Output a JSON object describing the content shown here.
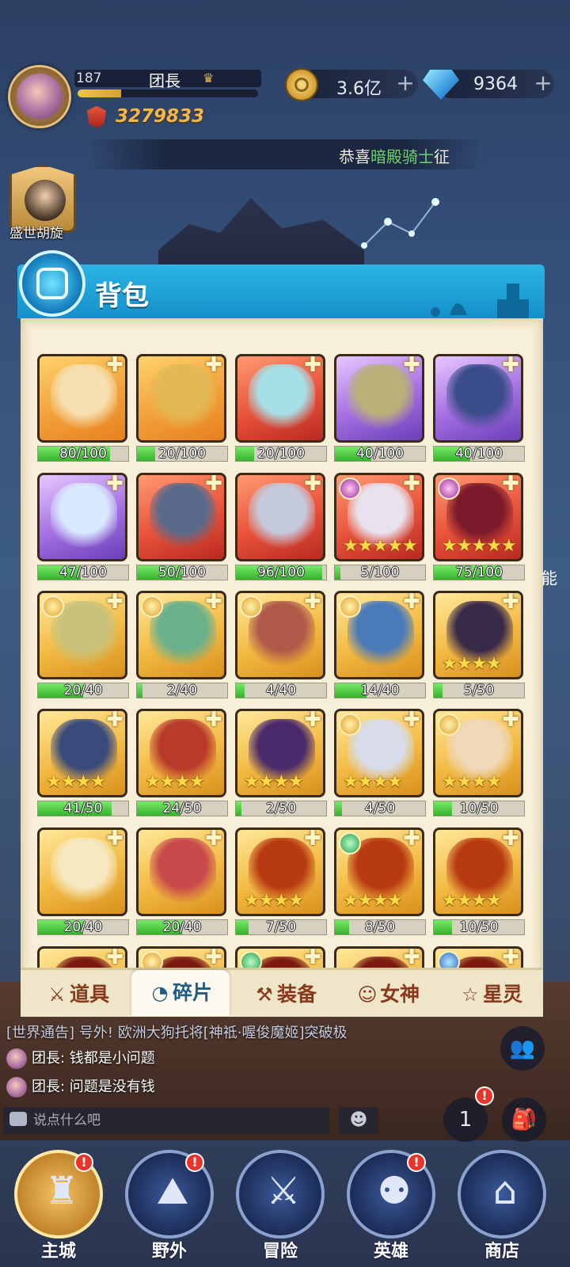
{
  "hud": {
    "level": "187",
    "player_name": "团長",
    "exp_fraction": 0.24,
    "power": "3279833",
    "gold": "3.6亿",
    "diamonds": "9364",
    "plus": "+",
    "marquee_prefix": "恭喜",
    "marquee_highlight": "暗殿骑士",
    "marquee_suffix": "征"
  },
  "event": {
    "label": "盛世胡旋"
  },
  "panel": {
    "title": "背包"
  },
  "items": [
    {
      "color": "orange",
      "art": "#f6e0b0",
      "count": "80/100",
      "fill": 0.8,
      "stars": "",
      "badge": ""
    },
    {
      "color": "orange",
      "art": "#e3b955",
      "count": "20/100",
      "fill": 0.2,
      "stars": "",
      "badge": ""
    },
    {
      "color": "red",
      "art": "#a7dfe6",
      "count": "20/100",
      "fill": 0.2,
      "stars": "",
      "badge": ""
    },
    {
      "color": "purple",
      "art": "#b9b07a",
      "count": "40/100",
      "fill": 0.4,
      "stars": "",
      "badge": ""
    },
    {
      "color": "purple",
      "art": "#3a4c8a",
      "count": "40/100",
      "fill": 0.4,
      "stars": "",
      "badge": ""
    },
    {
      "color": "purple",
      "art": "#d9e9ff",
      "count": "47/100",
      "fill": 0.47,
      "stars": "",
      "badge": ""
    },
    {
      "color": "red",
      "art": "#5a6a8a",
      "count": "50/100",
      "fill": 0.5,
      "stars": "",
      "badge": ""
    },
    {
      "color": "red",
      "art": "#c4c9dc",
      "count": "96/100",
      "fill": 0.96,
      "stars": "",
      "badge": ""
    },
    {
      "color": "red",
      "art": "#e8e2ee",
      "count": "5/100",
      "fill": 0.05,
      "stars": "★★★★★",
      "badge": "pink"
    },
    {
      "color": "red",
      "art": "#7a1a2a",
      "count": "75/100",
      "fill": 0.75,
      "stars": "★★★★★",
      "badge": "pink"
    },
    {
      "color": "gold",
      "art": "#c9c27a",
      "count": "20/40",
      "fill": 0.5,
      "stars": "",
      "badge": "gold"
    },
    {
      "color": "gold",
      "art": "#6ab08a",
      "count": "2/40",
      "fill": 0.05,
      "stars": "",
      "badge": "gold"
    },
    {
      "color": "gold",
      "art": "#b05a4a",
      "count": "4/40",
      "fill": 0.1,
      "stars": "",
      "badge": "gold"
    },
    {
      "color": "gold",
      "art": "#4a7ab8",
      "count": "14/40",
      "fill": 0.35,
      "stars": "",
      "badge": "gold"
    },
    {
      "color": "gold",
      "art": "#3a2a4a",
      "count": "5/50",
      "fill": 0.1,
      "stars": "★★★★",
      "badge": ""
    },
    {
      "color": "gold",
      "art": "#3a4a7a",
      "count": "41/50",
      "fill": 0.82,
      "stars": "★★★★",
      "badge": ""
    },
    {
      "color": "gold",
      "art": "#b83a2a",
      "count": "24/50",
      "fill": 0.48,
      "stars": "★★★★",
      "badge": ""
    },
    {
      "color": "gold",
      "art": "#4a2a6a",
      "count": "2/50",
      "fill": 0.04,
      "stars": "★★★★",
      "badge": ""
    },
    {
      "color": "gold",
      "art": "#d8dce8",
      "count": "4/50",
      "fill": 0.08,
      "stars": "★★★★",
      "badge": "gold"
    },
    {
      "color": "gold",
      "art": "#f0d8b8",
      "count": "10/50",
      "fill": 0.2,
      "stars": "★★★★",
      "badge": "gold"
    },
    {
      "color": "gold",
      "art": "#f6e8c0",
      "count": "20/40",
      "fill": 0.5,
      "stars": "",
      "badge": ""
    },
    {
      "color": "gold",
      "art": "#c84a4a",
      "count": "20/40",
      "fill": 0.5,
      "stars": "",
      "badge": ""
    },
    {
      "color": "gold",
      "art": "#b83a10",
      "count": "7/50",
      "fill": 0.14,
      "stars": "★★★★",
      "badge": ""
    },
    {
      "color": "gold",
      "art": "#b83a10",
      "count": "8/50",
      "fill": 0.16,
      "stars": "★★★★",
      "badge": "green"
    },
    {
      "color": "gold",
      "art": "#b83a10",
      "count": "10/50",
      "fill": 0.2,
      "stars": "★★★★",
      "badge": ""
    },
    {
      "color": "gold",
      "art": "#7a1a10",
      "count": "",
      "fill": 0,
      "stars": "",
      "badge": ""
    },
    {
      "color": "gold",
      "art": "#7a1a10",
      "count": "",
      "fill": 0,
      "stars": "",
      "badge": "gold"
    },
    {
      "color": "gold",
      "art": "#7a1a10",
      "count": "",
      "fill": 0,
      "stars": "",
      "badge": "green"
    },
    {
      "color": "gold",
      "art": "#7a1a10",
      "count": "",
      "fill": 0,
      "stars": "",
      "badge": ""
    },
    {
      "color": "gold",
      "art": "#7a1a10",
      "count": "",
      "fill": 0,
      "stars": "",
      "badge": "blue"
    }
  ],
  "tabs": [
    {
      "label": "道具",
      "icon": "⚔"
    },
    {
      "label": "碎片",
      "icon": "◔"
    },
    {
      "label": "装备",
      "icon": "⚒"
    },
    {
      "label": "女神",
      "icon": "☺"
    },
    {
      "label": "星灵",
      "icon": "☆"
    }
  ],
  "chat": {
    "notice": "[世界通告] 号外! 欧洲大狗托将[神祗·喔俊魔姬]突破极",
    "line1_name": "团長",
    "line1_text": "钱都是小问题",
    "line2_name": "团長",
    "line2_text": "问题是没有钱",
    "input_placeholder": "说点什么吧",
    "emoji": "☻"
  },
  "side": {
    "label": "能",
    "rank_num": "1"
  },
  "nav": [
    {
      "label": "主城",
      "glyph": "♜",
      "alert": "!"
    },
    {
      "label": "野外",
      "glyph": "⛰",
      "alert": "!"
    },
    {
      "label": "冒险",
      "glyph": "⚔",
      "alert": ""
    },
    {
      "label": "英雄",
      "glyph": "⚉",
      "alert": "!"
    },
    {
      "label": "商店",
      "glyph": "⌂",
      "alert": ""
    }
  ]
}
